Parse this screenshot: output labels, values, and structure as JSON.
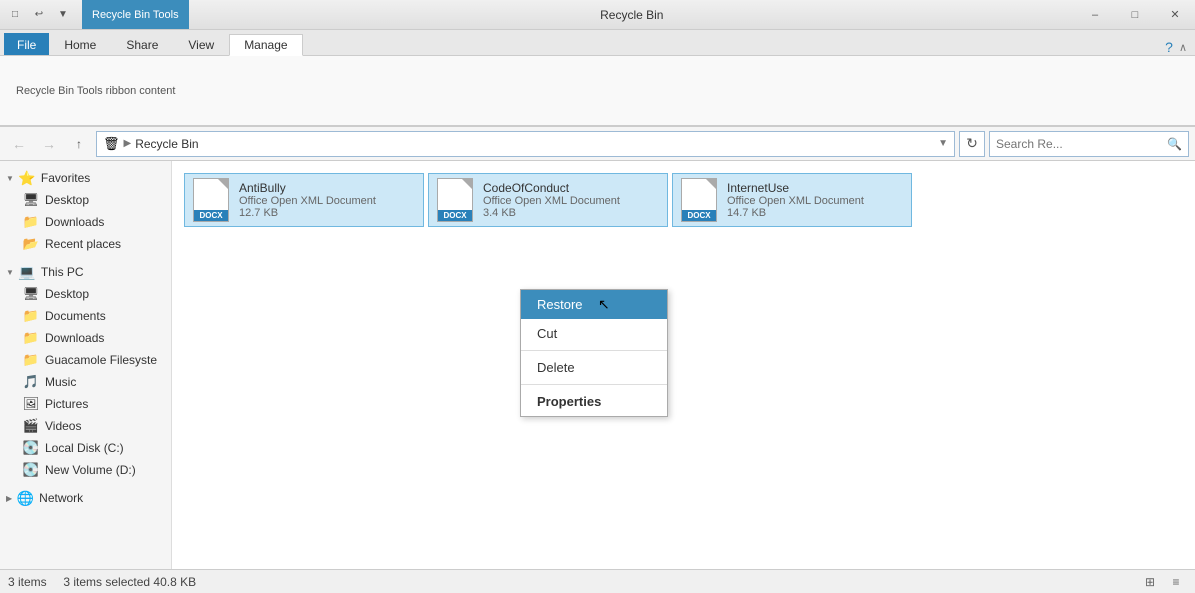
{
  "titleBar": {
    "title": "Recycle Bin",
    "ribbonTabActive": "Recycle Bin Tools",
    "controls": {
      "minimize": "–",
      "maximize": "□",
      "close": "✕"
    },
    "quickAccess": [
      "□",
      "↩",
      "▼"
    ]
  },
  "ribbon": {
    "tabs": [
      "File",
      "Home",
      "Share",
      "View",
      "Manage"
    ],
    "activeTab": "Manage",
    "helpIcon": "?",
    "expandIcon": "∧"
  },
  "navBar": {
    "backBtn": "←",
    "forwardBtn": "→",
    "upBtn": "↑",
    "path": "Recycle Bin",
    "pathIcon": "🗑",
    "refreshIcon": "↻",
    "searchPlaceholder": "Search Re...",
    "searchIcon": "🔍"
  },
  "sidebar": {
    "favorites": {
      "label": "Favorites",
      "items": [
        {
          "name": "Desktop",
          "icon": "🖥"
        },
        {
          "name": "Downloads",
          "icon": "📁"
        },
        {
          "name": "Recent places",
          "icon": "📂"
        }
      ]
    },
    "thisPC": {
      "label": "This PC",
      "items": [
        {
          "name": "Desktop",
          "icon": "🖥"
        },
        {
          "name": "Documents",
          "icon": "📁"
        },
        {
          "name": "Downloads",
          "icon": "📁"
        },
        {
          "name": "Guacamole Filesyste",
          "icon": "📁"
        },
        {
          "name": "Music",
          "icon": "🎵"
        },
        {
          "name": "Pictures",
          "icon": "🖼"
        },
        {
          "name": "Videos",
          "icon": "🎬"
        },
        {
          "name": "Local Disk (C:)",
          "icon": "💽"
        },
        {
          "name": "New Volume (D:)",
          "icon": "💽"
        }
      ]
    },
    "network": {
      "label": "Network",
      "icon": "🌐"
    }
  },
  "files": [
    {
      "name": "AntiBully",
      "type": "Office Open XML Document",
      "size": "12.7 KB",
      "ext": "DOCX",
      "selected": true
    },
    {
      "name": "CodeOfConduct",
      "type": "Office Open XML Document",
      "size": "3.4 KB",
      "ext": "DOCX",
      "selected": true
    },
    {
      "name": "InternetUse",
      "type": "Office Open XML Document",
      "size": "14.7 KB",
      "ext": "DOCX",
      "selected": true
    }
  ],
  "contextMenu": {
    "items": [
      {
        "label": "Restore",
        "bold": false,
        "hover": true
      },
      {
        "label": "Cut",
        "bold": false,
        "hover": false
      },
      {
        "label": "Delete",
        "bold": false,
        "hover": false
      },
      {
        "label": "Properties",
        "bold": true,
        "hover": false
      }
    ]
  },
  "statusBar": {
    "itemCount": "3 items",
    "selectedInfo": "3 items selected  40.8 KB",
    "viewIcons": [
      "⊞",
      "≡"
    ]
  }
}
